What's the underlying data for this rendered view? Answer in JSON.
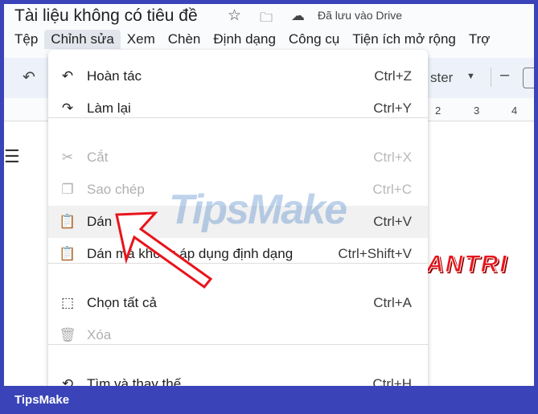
{
  "title": "Tài liệu không có tiêu đề",
  "saved_status": "Đã lưu vào Drive",
  "icons": {
    "star": "star-icon",
    "folder": "move-folder-icon",
    "cloud": "cloud-saved-icon"
  },
  "menubar": [
    "Tệp",
    "Chỉnh sửa",
    "Xem",
    "Chèn",
    "Định dạng",
    "Công cụ",
    "Tiện ích mở rộng",
    "Trợ"
  ],
  "toolbar": {
    "font": "ster",
    "minus": "–"
  },
  "ruler": [
    "2",
    "3",
    "4"
  ],
  "doc_text": "ANTRI",
  "menu": {
    "items": [
      {
        "icon": "↶",
        "label": "Hoàn tác",
        "shortcut": "Ctrl+Z",
        "disabled": false
      },
      {
        "icon": "↷",
        "label": "Làm lại",
        "shortcut": "Ctrl+Y",
        "disabled": false
      },
      {
        "icon": "✂",
        "label": "Cắt",
        "shortcut": "Ctrl+X",
        "disabled": true
      },
      {
        "icon": "❐",
        "label": "Sao chép",
        "shortcut": "Ctrl+C",
        "disabled": true
      },
      {
        "icon": "📋",
        "label": "Dán",
        "shortcut": "Ctrl+V",
        "disabled": false,
        "highlighted": true
      },
      {
        "icon": "📋",
        "label": "Dán mà không áp dụng định dạng",
        "shortcut": "Ctrl+Shift+V",
        "disabled": false
      },
      {
        "icon": "⬚",
        "label": "Chọn tất cả",
        "shortcut": "Ctrl+A",
        "disabled": false
      },
      {
        "icon": "🗑",
        "label": "Xóa",
        "shortcut": "",
        "disabled": true
      },
      {
        "icon": "⟲",
        "label": "Tìm và thay thế",
        "shortcut": "Ctrl+H",
        "disabled": false
      }
    ]
  },
  "watermark": "TipsMake",
  "footer": "TipsMake",
  "colors": {
    "frame": "#3a44b8",
    "arrow": "#e8141c"
  }
}
